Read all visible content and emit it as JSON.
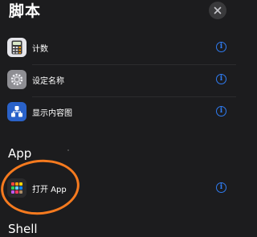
{
  "header": {
    "title": "脚本",
    "close_icon": "close-icon"
  },
  "actions": [
    {
      "label": "计数",
      "icon": "calculator-icon"
    },
    {
      "label": "设定名称",
      "icon": "gear-icon"
    },
    {
      "label": "显示内容图",
      "icon": "content-graph-icon"
    }
  ],
  "sections": {
    "app": {
      "title": "App",
      "items": [
        {
          "label": "打开 App",
          "icon": "app-grid-icon"
        }
      ]
    },
    "shell": {
      "title": "Shell"
    }
  },
  "info_glyph": "i",
  "colors": {
    "background": "#1c1c1e",
    "accent": "#2f7bf0",
    "highlight": "#f57a1f"
  }
}
